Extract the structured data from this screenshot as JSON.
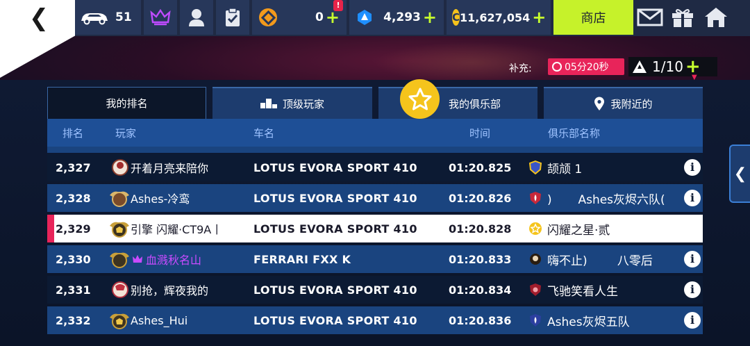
{
  "topbar": {
    "back_glyph": "❮",
    "car_count": "51",
    "tokens_value": "0",
    "tokens_badge": "!",
    "blueprints_value": "4,293",
    "credits_icon_letter": "C",
    "credits_value": "11,627,054",
    "plus_symbol": "+",
    "shop_label": "商店",
    "icons": [
      "car-icon",
      "crown-icon",
      "profile-icon",
      "tasks-icon",
      "token-icon",
      "blueprint-icon",
      "credits-icon",
      "mail-icon",
      "gift-icon",
      "home-icon"
    ]
  },
  "refill": {
    "label": "补充:",
    "timer": "05分20秒",
    "tickets": "1/10"
  },
  "tabs": [
    {
      "label": "我的排名",
      "active": true
    },
    {
      "label": "顶级玩家",
      "active": false
    },
    {
      "label": "我的俱乐部",
      "active": false
    },
    {
      "label": "我附近的",
      "active": false
    }
  ],
  "headers": {
    "rank": "排名",
    "player": "玩家",
    "car": "车名",
    "time": "时间",
    "club": "俱乐部名称"
  },
  "rows": [
    {
      "rank": "2,327",
      "player": "开着月亮来陪你",
      "car": "LOTUS EVORA SPORT 410",
      "time": "01:20.825",
      "club": "颉颃 1",
      "info": "i",
      "style": "dark"
    },
    {
      "rank": "2,328",
      "player": "Ashes-冷鸾",
      "car": "LOTUS EVORA SPORT 410",
      "time": "01:20.826",
      "club": ")       Ashes灰烬六队(",
      "info": "i",
      "style": "blue"
    },
    {
      "rank": "2,329",
      "player": "引擎      闪耀·CT9A丨",
      "car": "LOTUS EVORA SPORT 410",
      "time": "01:20.828",
      "club": "闪耀之星·贰",
      "info": "",
      "style": "me"
    },
    {
      "rank": "2,330",
      "player": "血溅秋名山",
      "car": "FERRARI FXX K",
      "time": "01:20.833",
      "club": "嗨不止)        八零后",
      "info": "i",
      "style": "blue"
    },
    {
      "rank": "2,331",
      "player": "别抢，辉夜我的",
      "car": "LOTUS EVORA SPORT 410",
      "time": "01:20.834",
      "club": "飞驰笑看人生",
      "info": "i",
      "style": "dark"
    },
    {
      "rank": "2,332",
      "player": "Ashes_Hui",
      "car": "LOTUS EVORA SPORT 410",
      "time": "01:20.836",
      "club": "Ashes灰烬五队",
      "info": "i",
      "style": "blue"
    }
  ],
  "side_arrow": "❮",
  "colors": {
    "accent_green": "#c6f22a",
    "highlight_pink": "#e8245a",
    "gold": "#f5c41c",
    "tab_blue": "#1d3c6e",
    "header_blue": "#1e4f96"
  }
}
